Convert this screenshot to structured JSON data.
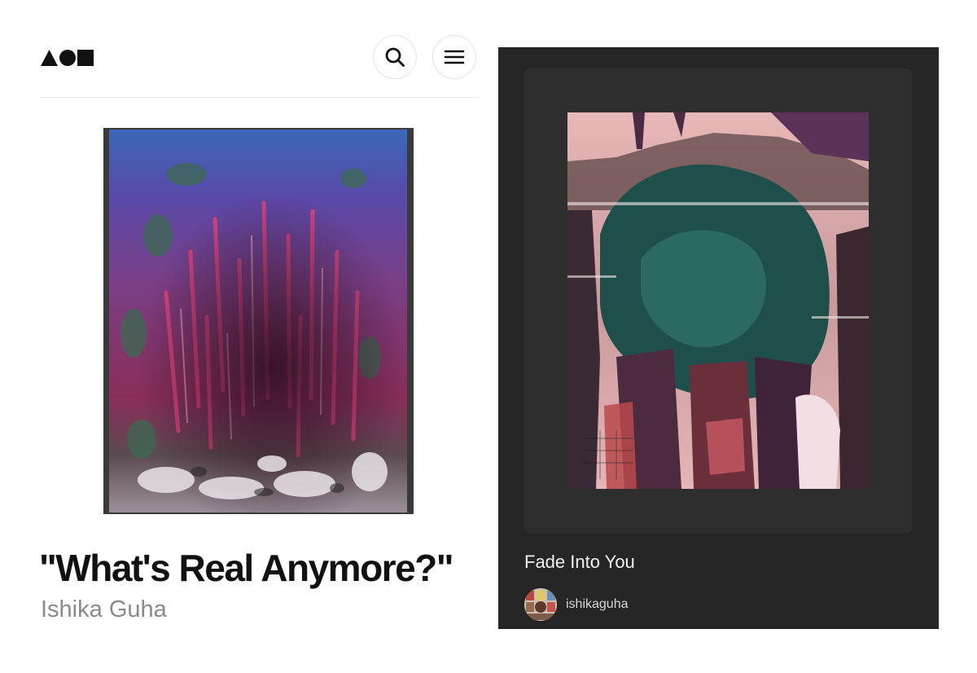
{
  "left_panel": {
    "logo_icon": "triangle-circle-square-logo",
    "search_icon": "search-icon",
    "menu_icon": "hamburger-menu-icon",
    "artwork": {
      "title": "\"What's Real Anymore?\"",
      "artist": "Ishika Guha"
    }
  },
  "right_panel": {
    "artwork": {
      "title": "Fade Into You"
    },
    "user": {
      "username": "ishikaguha"
    }
  },
  "colors": {
    "left_background": "#ffffff",
    "right_background": "#262626",
    "title_text": "#111111",
    "artist_text": "#8a8a8a"
  }
}
